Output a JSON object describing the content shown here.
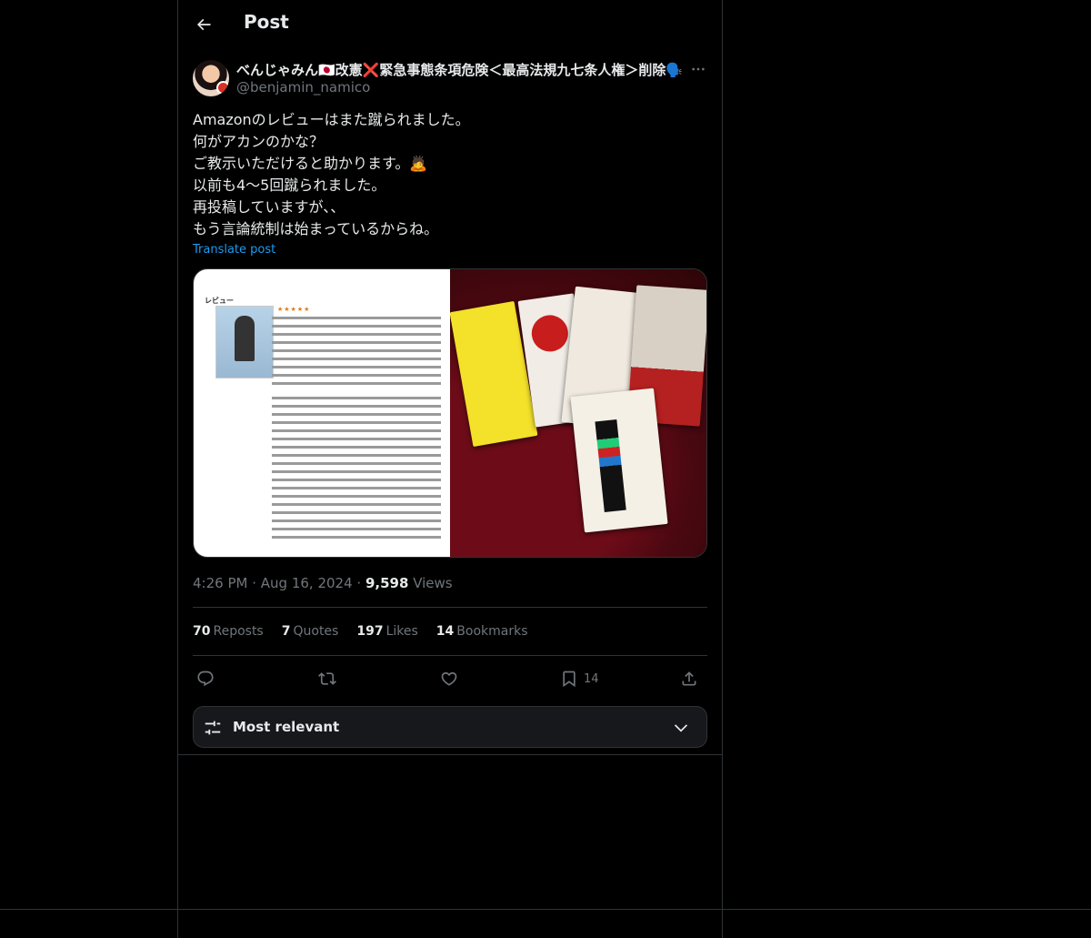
{
  "header": {
    "title": "Post"
  },
  "author": {
    "display_name": "べんじゃみん🇯🇵改憲❌緊急事態条項危険＜最高法規九七条人権＞削除🗣️",
    "handle": "@benjamin_namico"
  },
  "tweet": {
    "lines": [
      "Amazonのレビューはまた蹴られました。",
      "何がアカンのかな？",
      "ご教示いただけると助かります。🙇",
      "以前も4〜5回蹴られました。",
      "再投稿していますが、、",
      "もう言論統制は始まっているからね。"
    ],
    "translate_label": "Translate post"
  },
  "media": {
    "review_heading": "レビュー",
    "review_stars": "★★★★★"
  },
  "meta": {
    "time": "4:26 PM",
    "date": "Aug 16, 2024",
    "views_count": "9,598",
    "views_label": "Views"
  },
  "stats": {
    "reposts_count": "70",
    "reposts_label": "Reposts",
    "quotes_count": "7",
    "quotes_label": "Quotes",
    "likes_count": "197",
    "likes_label": "Likes",
    "bookmarks_count": "14",
    "bookmarks_label": "Bookmarks"
  },
  "actions": {
    "bookmark_count": "14"
  },
  "sort": {
    "label": "Most relevant"
  },
  "icons": {
    "back": "arrow-left-icon",
    "more": "more-dots-icon",
    "reply": "reply-icon",
    "repost": "repost-icon",
    "like": "heart-icon",
    "bookmark": "bookmark-icon",
    "share": "share-icon",
    "sort": "sliders-icon",
    "chevron": "chevron-down-icon"
  },
  "colors": {
    "background": "#000000",
    "text": "#e7e9ea",
    "secondary": "#71767b",
    "link": "#1d9bf0",
    "border": "#2f3336"
  }
}
